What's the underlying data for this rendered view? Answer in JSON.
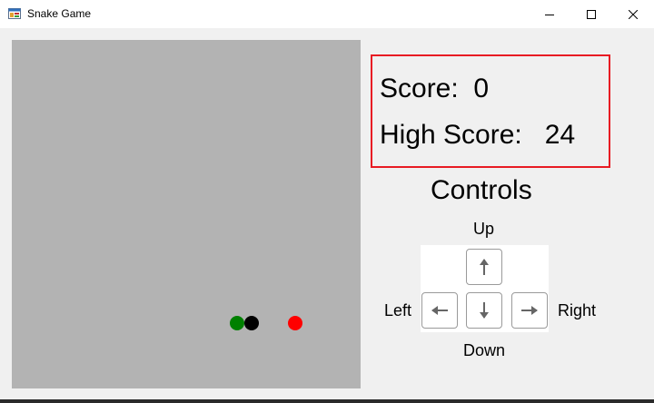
{
  "window": {
    "title": "Snake Game",
    "icons": {
      "app": "app-icon",
      "minimize": "minimize-icon",
      "maximize": "maximize-icon",
      "close": "close-icon"
    }
  },
  "game": {
    "board_color": "#b3b3b3",
    "snake_head_color": "#008000",
    "snake_body_color": "#000000",
    "food_color": "#ff0000"
  },
  "score": {
    "label": "Score:",
    "value": "0",
    "high_label": "High Score:",
    "high_value": "24",
    "border_color": "#e81b23"
  },
  "controls": {
    "title": "Controls",
    "up_label": "Up",
    "down_label": "Down",
    "left_label": "Left",
    "right_label": "Right",
    "icons": {
      "up": "arrow-up-icon",
      "down": "arrow-down-icon",
      "left": "arrow-left-icon",
      "right": "arrow-right-icon"
    }
  }
}
